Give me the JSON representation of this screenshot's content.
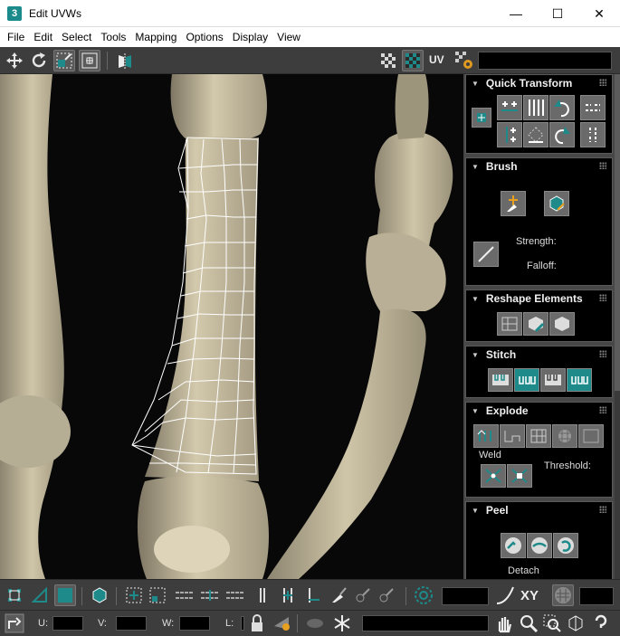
{
  "window": {
    "app_icon_text": "3",
    "title": "Edit UVWs",
    "minimize_glyph": "—",
    "maximize_glyph": "☐",
    "close_glyph": "✕"
  },
  "menu": [
    "File",
    "Edit",
    "Select",
    "Tools",
    "Mapping",
    "Options",
    "Display",
    "View"
  ],
  "toolbar_top": {
    "uv_label": "UV",
    "icons": [
      "move-icon",
      "rotate-icon",
      "scale-icon",
      "freeform-icon",
      "mirror-icon",
      "checker-off-icon",
      "checker-on-icon",
      "uv-label-icon",
      "texture-settings-icon"
    ]
  },
  "rollouts": {
    "quick_transform": {
      "title": "Quick Transform"
    },
    "brush": {
      "title": "Brush",
      "strength_label": "Strength:",
      "falloff_label": "Falloff:"
    },
    "reshape": {
      "title": "Reshape Elements"
    },
    "stitch": {
      "title": "Stitch"
    },
    "explode": {
      "title": "Explode",
      "weld_label": "Weld",
      "threshold_label": "Threshold:"
    },
    "peel": {
      "title": "Peel",
      "detach_label": "Detach"
    }
  },
  "bottom": {
    "xy_label": "XY",
    "u_label": "U:",
    "v_label": "V:",
    "w_label": "W:",
    "l_label": "L:"
  },
  "colors": {
    "accent_teal": "#1e8a8a",
    "panel_bg": "#474747",
    "toolbar_bg": "#3d3d3d",
    "viewport_bg": "#080808",
    "bone": "#c9bfa2",
    "uv_mesh": "#ffffff"
  }
}
